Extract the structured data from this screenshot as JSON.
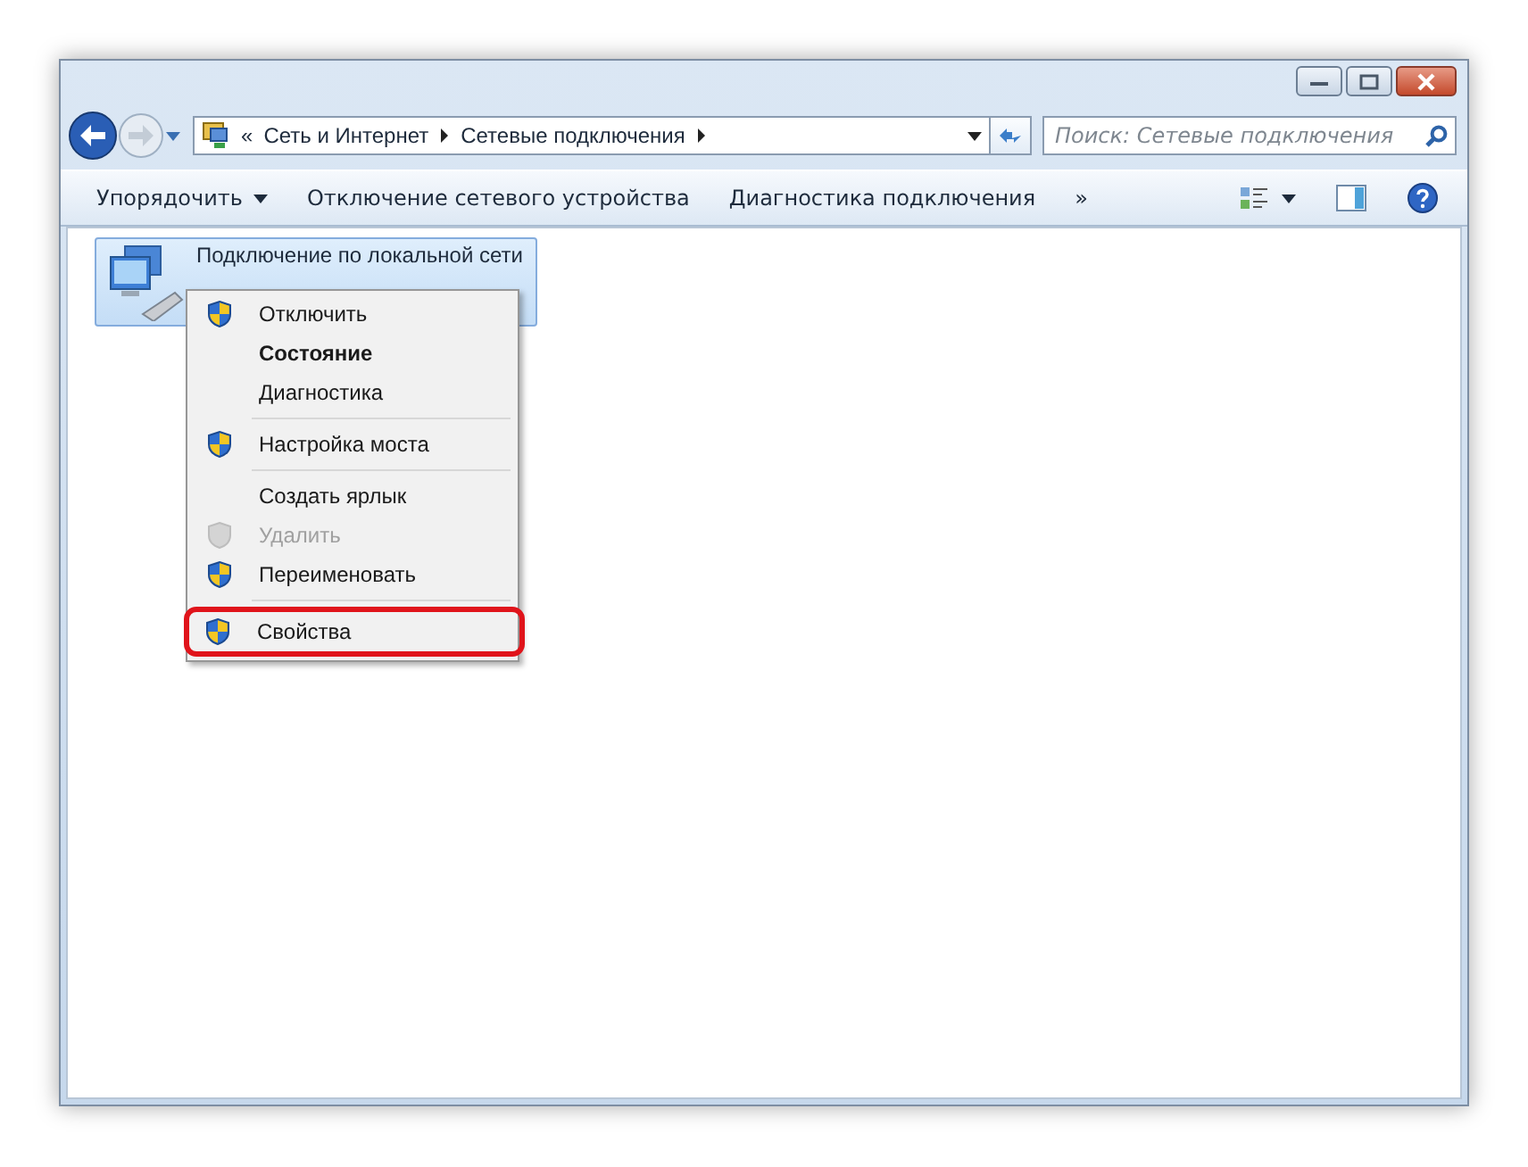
{
  "address_bar": {
    "overflow": "«",
    "crumbs": [
      "Сеть и Интернет",
      "Сетевые подключения"
    ]
  },
  "search": {
    "placeholder": "Поиск: Сетевые подключения"
  },
  "toolbar": {
    "items": [
      {
        "label": "Упорядочить",
        "dropdown": true
      },
      {
        "label": "Отключение сетевого устройства",
        "dropdown": false
      },
      {
        "label": "Диагностика подключения",
        "dropdown": false
      }
    ],
    "more": "»"
  },
  "connection": {
    "name": "Подключение по локальной сети",
    "selected": true
  },
  "context_menu": [
    {
      "kind": "item",
      "label": "Отключить",
      "shield": true,
      "bold": false,
      "disabled": false,
      "highlighted": false
    },
    {
      "kind": "item",
      "label": "Состояние",
      "shield": false,
      "bold": true,
      "disabled": false,
      "highlighted": false
    },
    {
      "kind": "item",
      "label": "Диагностика",
      "shield": false,
      "bold": false,
      "disabled": false,
      "highlighted": false
    },
    {
      "kind": "separator"
    },
    {
      "kind": "item",
      "label": "Настройка моста",
      "shield": true,
      "bold": false,
      "disabled": false,
      "highlighted": false
    },
    {
      "kind": "separator"
    },
    {
      "kind": "item",
      "label": "Создать ярлык",
      "shield": false,
      "bold": false,
      "disabled": false,
      "highlighted": false
    },
    {
      "kind": "item",
      "label": "Удалить",
      "shield": true,
      "bold": false,
      "disabled": true,
      "highlighted": false
    },
    {
      "kind": "item",
      "label": "Переименовать",
      "shield": true,
      "bold": false,
      "disabled": false,
      "highlighted": false
    },
    {
      "kind": "separator"
    },
    {
      "kind": "item",
      "label": "Свойства",
      "shield": true,
      "bold": false,
      "disabled": false,
      "highlighted": true
    }
  ]
}
